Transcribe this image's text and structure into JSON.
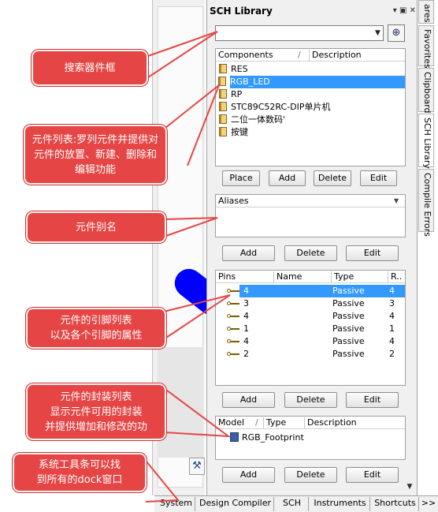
{
  "panel": {
    "title": "SCH Library",
    "title_buttons": "▾ ▣ ✕",
    "search_button": "⊕"
  },
  "components": {
    "col_components": "Components",
    "col_slash": "/",
    "col_description": "Description",
    "items": [
      "RES",
      "RGB_LED",
      "RP",
      "STC89C52RC-DIP单片机",
      "二位一体数码'",
      "按键"
    ],
    "selected": "RGB_LED",
    "buttons": {
      "place": "Place",
      "add": "Add",
      "delete": "Delete",
      "edit": "Edit"
    }
  },
  "aliases": {
    "header": "Aliases",
    "buttons": {
      "add": "Add",
      "delete": "Delete",
      "edit": "Edit"
    }
  },
  "pins": {
    "col_pins": "Pins",
    "col_name": "Name",
    "col_type": "Type",
    "col_r": "R..",
    "rows": [
      {
        "pin": "4",
        "name": "",
        "type": "Passive",
        "r": "4"
      },
      {
        "pin": "3",
        "name": "",
        "type": "Passive",
        "r": "3"
      },
      {
        "pin": "4",
        "name": "",
        "type": "Passive",
        "r": "4"
      },
      {
        "pin": "1",
        "name": "",
        "type": "Passive",
        "r": "1"
      },
      {
        "pin": "4",
        "name": "",
        "type": "Passive",
        "r": "4"
      },
      {
        "pin": "2",
        "name": "",
        "type": "Passive",
        "r": "2"
      }
    ],
    "buttons": {
      "add": "Add",
      "delete": "Delete",
      "edit": "Edit"
    }
  },
  "models": {
    "col_model": "Model",
    "col_slash": "/",
    "col_type": "Type",
    "col_description": "Description",
    "items": [
      "RGB_Footprint"
    ],
    "buttons": {
      "add": "Add",
      "delete": "Delete",
      "edit": "Edit"
    }
  },
  "side_tabs": [
    "ares",
    "Favorites",
    "Clipboard",
    "SCH Library",
    "Compile Errors"
  ],
  "bottom_tabs": [
    "System",
    "Design Compiler",
    "SCH",
    "Instruments",
    "Shortcuts",
    ">>"
  ],
  "callouts": {
    "search": "搜索器件框",
    "components_list": "元件列表:罗列元件并提供对元件的放置、新建、删除和编辑功能",
    "aliases": "元件别名",
    "pins": "元件的引脚列表\n以及各个引脚的属性",
    "footprint": "元件的封装列表\n显示元件可用的封装\n并提供增加和修改的功",
    "system": "系统工具条可以找\n到所有的dock窗口"
  },
  "colors": {
    "callout": "#e64545",
    "selection": "#3399ff",
    "capsule": "#0000ff"
  }
}
